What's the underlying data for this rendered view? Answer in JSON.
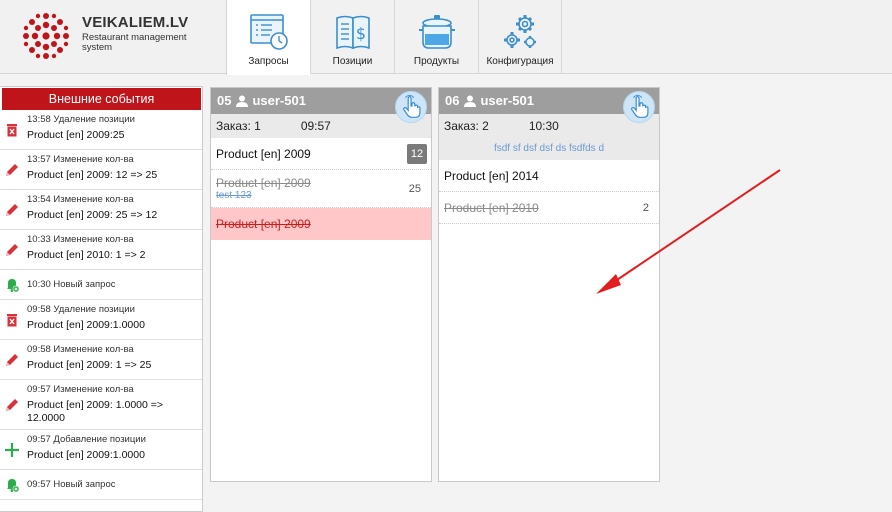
{
  "app": {
    "title": "VEIKALIEM.LV",
    "subtitle": "Restaurant management system"
  },
  "nav": [
    {
      "label": "Запросы",
      "icon": "requests-icon",
      "active": true
    },
    {
      "label": "Позиции",
      "icon": "menu-price-icon",
      "active": false
    },
    {
      "label": "Продукты",
      "icon": "cooking-pot-icon",
      "active": false
    },
    {
      "label": "Конфигурация",
      "icon": "gears-icon",
      "active": false
    }
  ],
  "sidebar": {
    "title": "Внешние события",
    "events": [
      {
        "icon": "delete-icon",
        "head": "13:58 Удаление позиции",
        "body": "Product [en] 2009:25"
      },
      {
        "icon": "pencil-icon",
        "head": "13:57 Изменение кол-ва",
        "body": "Product [en] 2009: 12 => 25"
      },
      {
        "icon": "pencil-icon",
        "head": "13:54 Изменение кол-ва",
        "body": "Product [en] 2009: 25 => 12"
      },
      {
        "icon": "pencil-icon",
        "head": "10:33 Изменение кол-ва",
        "body": "Product [en] 2010: 1 => 2"
      },
      {
        "icon": "bell-add-icon",
        "head": "10:30 Новый запрос",
        "body": ""
      },
      {
        "icon": "delete-icon",
        "head": "09:58 Удаление позиции",
        "body": "Product [en] 2009:1.0000"
      },
      {
        "icon": "pencil-icon",
        "head": "09:58 Изменение кол-ва",
        "body": "Product [en] 2009: 1 => 25"
      },
      {
        "icon": "pencil-icon",
        "head": "09:57 Изменение кол-ва",
        "body": "Product [en] 2009: 1.0000 => 12.0000"
      },
      {
        "icon": "plus-icon",
        "head": "09:57 Добавление позиции",
        "body": "Product [en] 2009:1.0000"
      },
      {
        "icon": "bell-add-icon",
        "head": "09:57 Новый запрос",
        "body": ""
      }
    ]
  },
  "cards": [
    {
      "table": "05",
      "user": "user-501",
      "order_label": "Заказ: 1",
      "time": "09:57",
      "note": "",
      "items": [
        {
          "name": "Product [en] 2009",
          "qty": "12",
          "state": "active",
          "sub": ""
        },
        {
          "name": "Product [en] 2009",
          "qty": "25",
          "state": "done",
          "sub": "test 123"
        },
        {
          "name": "Product [en] 2009",
          "qty": "",
          "state": "cancelled",
          "sub": ""
        }
      ]
    },
    {
      "table": "06",
      "user": "user-501",
      "order_label": "Заказ: 2",
      "time": "10:30",
      "note": "fsdf sf dsf dsf ds fsdfds d",
      "items": [
        {
          "name": "Product [en] 2014",
          "qty": "",
          "state": "active",
          "sub": ""
        },
        {
          "name": "Product [en] 2010",
          "qty": "2",
          "state": "done",
          "sub": ""
        }
      ]
    }
  ],
  "colors": {
    "accent": "#c0141b",
    "header_gray": "#9e9e9e",
    "cancel_bg": "#ffc7c7",
    "note_blue": "#6a9bd0"
  }
}
